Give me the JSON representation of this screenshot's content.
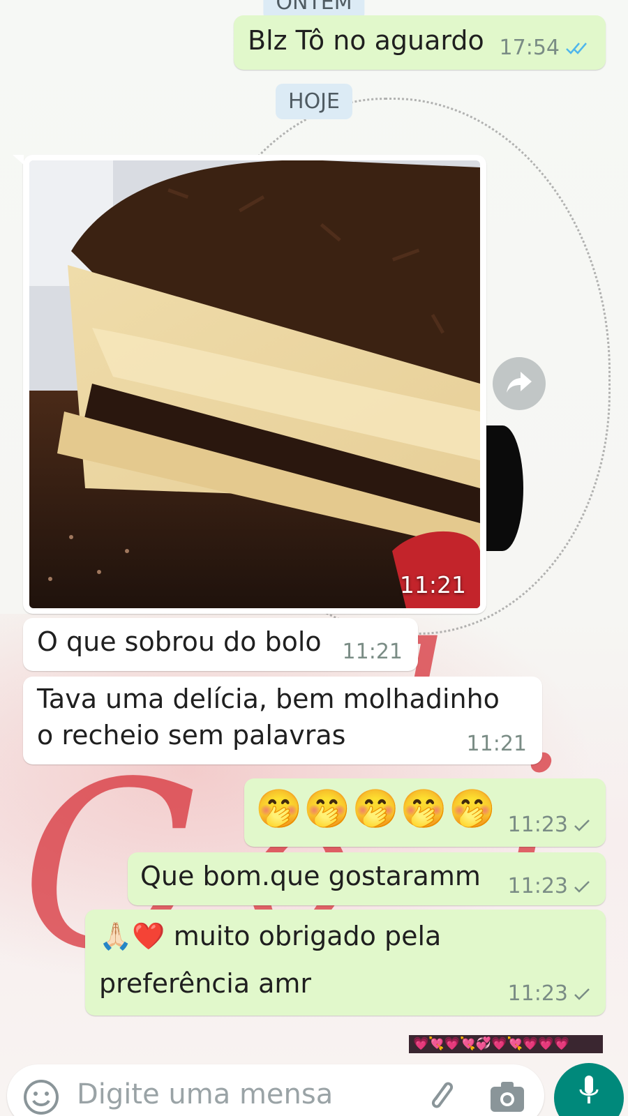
{
  "chat": {
    "date_yesterday": "ONTEM",
    "msg1": {
      "text": "Blz Tô no aguardo",
      "time": "17:54",
      "status": "read"
    },
    "date_today": "HOJE",
    "photo": {
      "time": "11:21"
    },
    "msg2": {
      "text": "O que sobrou do bolo",
      "time": "11:21"
    },
    "msg3": {
      "line1": "Tava uma delícia, bem molhadinho",
      "line2": "o recheio sem palavras",
      "time": "11:21"
    },
    "msg4": {
      "emojis": "🤭🤭🤭🤭🤭",
      "time": "11:23",
      "status": "sent"
    },
    "msg5": {
      "text": "Que bom.que gostaramm",
      "time": "11:23",
      "status": "sent"
    },
    "msg6": {
      "line1": "🙏🏻❤️ muito obrigado pela",
      "line2": "preferência amr",
      "time": "11:23",
      "status": "sent"
    },
    "sticker_preview": "💗💘💗💘💞💗💘💗💗💗"
  },
  "compose": {
    "placeholder": "Digite uma mensa"
  },
  "icons": {
    "forward": "forward-icon",
    "emoji": "emoji-icon",
    "attach": "paperclip-icon",
    "camera": "camera-icon",
    "mic": "microphone-icon",
    "read_receipt": "double-check-icon",
    "sent_receipt": "single-check-icon"
  },
  "colors": {
    "outgoing": "#e1f8cb",
    "incoming": "#ffffff",
    "date_chip": "#dcebf5",
    "mic_button": "#00897b",
    "read_tick": "#4fb6ec"
  }
}
